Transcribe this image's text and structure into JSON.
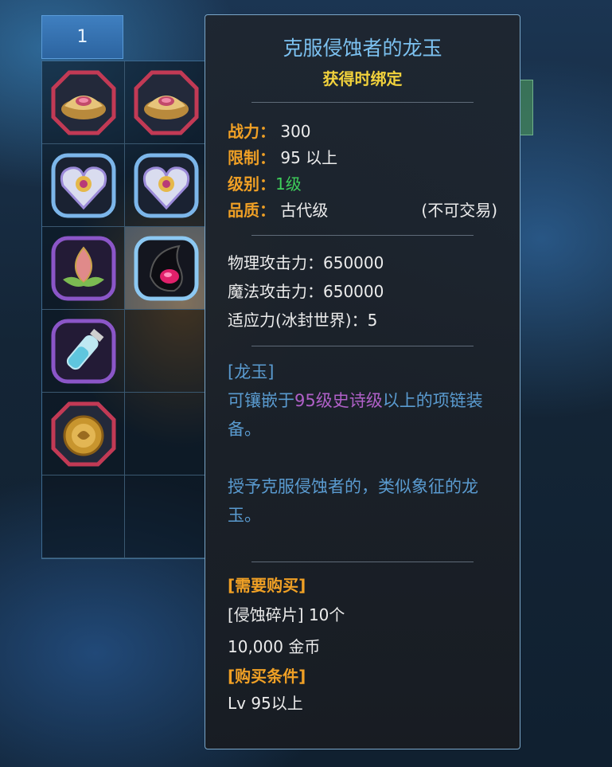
{
  "inventory": {
    "tab_label": "1",
    "slots": [
      {
        "icon": "gold-ingot-icon"
      },
      {
        "icon": "gold-ingot-icon"
      },
      {
        "icon": "heart-gem-icon"
      },
      {
        "icon": "heart-gem-icon"
      },
      {
        "icon": "lotus-bud-icon"
      },
      {
        "icon": "dark-claw-icon"
      },
      {
        "icon": "potion-vial-icon"
      },
      {
        "icon": "empty"
      },
      {
        "icon": "gold-medallion-icon"
      },
      {
        "icon": "empty"
      },
      {
        "icon": "empty"
      },
      {
        "icon": "empty"
      }
    ]
  },
  "tooltip": {
    "title": "克服侵蚀者的龙玉",
    "bind_text": "获得时绑定",
    "stats": {
      "power_label": "战力：",
      "power_value": "300",
      "limit_label": "限制：",
      "limit_value": "95 以上",
      "level_label": "级别：",
      "level_value": "1级",
      "quality_label": "品质：",
      "quality_value": "古代级",
      "trade_text": "(不可交易)"
    },
    "attributes": [
      "物理攻击力：650000",
      "魔法攻击力：650000",
      "适应力(冰封世界)：5"
    ],
    "description": {
      "category": "[龙玉]",
      "line_prefix": "可镶嵌于",
      "line_highlight": "95级史诗级",
      "line_mid": "以上的",
      "line_item": "项链装",
      "line_tail": "备。",
      "flavor_1": "授予克服侵蚀者的，类似象征的龙",
      "flavor_2": "玉。"
    },
    "purchase": {
      "need_header": "[需要购买]",
      "material": "[侵蚀碎片] 10个",
      "gold": "10,000 金币",
      "cond_header": "[购买条件]",
      "condition": "Lv 95以上"
    }
  },
  "colors": {
    "title": "#7cc1f0",
    "bind": "#f2d23c",
    "label": "#f0a025",
    "level": "#3ecf5a",
    "desc": "#5a9bd0",
    "highlight": "#b060c8"
  }
}
